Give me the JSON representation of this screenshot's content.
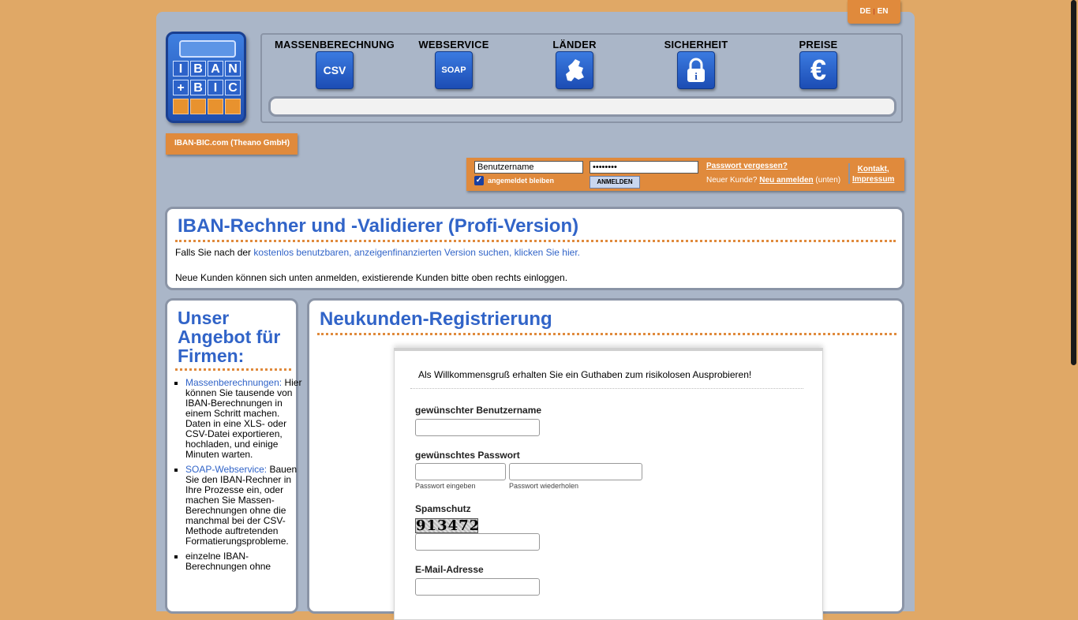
{
  "lang": {
    "de": "DE",
    "sep": "|",
    "en": "EN"
  },
  "logo": {
    "row1": [
      "I",
      "B",
      "A",
      "N"
    ],
    "row2": [
      "+",
      "B",
      "I",
      "C"
    ]
  },
  "nav": [
    {
      "label": "MASSENBERECHNUNG",
      "icon": "CSV"
    },
    {
      "label": "WEBSERVICE",
      "icon": "SOAP"
    },
    {
      "label": "LÄNDER",
      "icon": "europe-map-icon"
    },
    {
      "label": "SICHERHEIT",
      "icon": "lock-icon"
    },
    {
      "label": "PREISE",
      "icon": "€"
    }
  ],
  "company": "IBAN-BIC.com (Theano GmbH)",
  "login": {
    "username_value": "Benutzername",
    "password_value": "••••••••",
    "remember_label": "angemeldet bleiben",
    "button": "ANMELDEN",
    "forgot": "Passwort vergessen?",
    "newcust_prefix": "Neuer Kunde?",
    "newcust_link": "Neu anmelden",
    "newcust_suffix": "(unten)",
    "contact": "Kontakt,",
    "impressum": "Impressum"
  },
  "intro": {
    "title": "IBAN-Rechner und -Validierer (Profi-Version)",
    "line1_prefix": "Falls Sie nach der",
    "line1_link": "kostenlos benutzbaren, anzeigenfinanzierten Version suchen, klicken Sie hier.",
    "line2": "Neue Kunden können sich unten anmelden, existierende Kunden bitte oben rechts einloggen."
  },
  "offer": {
    "title": "Unser Angebot für Firmen:",
    "items": [
      {
        "link": "Massenberechnungen:",
        "text": "Hier können Sie tausende von IBAN-Berechnungen in einem Schritt machen. Daten in eine XLS- oder CSV-Datei exportieren, hochladen, und einige Minuten warten."
      },
      {
        "link": "SOAP-Webservice:",
        "text": "Bauen Sie den IBAN-Rechner in Ihre Prozesse ein, oder machen Sie Massen-Berechnungen ohne die manchmal bei der CSV-Methode auftretenden Formatierungsprobleme."
      },
      {
        "link": "",
        "text": "einzelne IBAN-Berechnungen ohne"
      }
    ]
  },
  "register": {
    "title": "Neukunden-Registrierung",
    "welcome": "Als Willkommensgruß erhalten Sie ein Guthaben zum risikolosen Ausprobieren!",
    "username_label": "gewünschter Benutzername",
    "password_label": "gewünschtes Passwort",
    "password_hint1": "Passwort eingeben",
    "password_hint2": "Passwort wiederholen",
    "spam_label": "Spamschutz",
    "captcha": "913472",
    "email_label": "E-Mail-Adresse"
  }
}
